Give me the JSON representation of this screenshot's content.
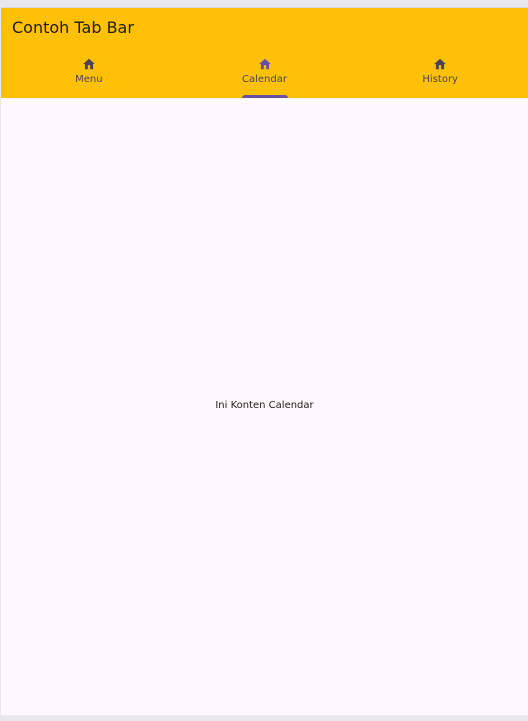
{
  "app": {
    "title": "Contoh Tab Bar",
    "colors": {
      "appbar": "#ffc107",
      "background": "#fff8fd",
      "active_icon": "#6750a4",
      "inactive_icon": "#4a4456",
      "indicator": "#6750a4"
    }
  },
  "tabs": [
    {
      "label": "Menu",
      "icon": "home-icon",
      "active": false
    },
    {
      "label": "Calendar",
      "icon": "home-icon",
      "active": true
    },
    {
      "label": "History",
      "icon": "home-icon",
      "active": false
    }
  ],
  "content": {
    "text": "Ini Konten Calendar"
  }
}
